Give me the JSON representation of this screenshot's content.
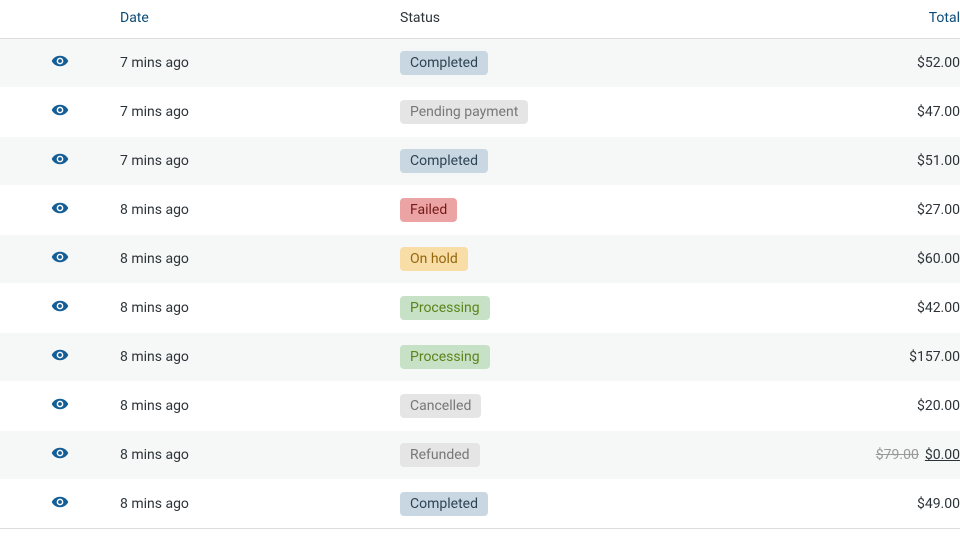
{
  "columns": {
    "date": {
      "label": "Date",
      "is_link": true
    },
    "status": {
      "label": "Status",
      "is_link": false
    },
    "total": {
      "label": "Total",
      "is_link": true
    }
  },
  "status_styles": {
    "Completed": "status-completed",
    "Pending payment": "status-pending",
    "Failed": "status-failed",
    "On hold": "status-onhold",
    "Processing": "status-processing",
    "Cancelled": "status-cancelled",
    "Refunded": "status-refunded"
  },
  "rows": [
    {
      "date": "7 mins ago",
      "status": "Completed",
      "total": "$52.00"
    },
    {
      "date": "7 mins ago",
      "status": "Pending payment",
      "total": "$47.00"
    },
    {
      "date": "7 mins ago",
      "status": "Completed",
      "total": "$51.00"
    },
    {
      "date": "8 mins ago",
      "status": "Failed",
      "total": "$27.00"
    },
    {
      "date": "8 mins ago",
      "status": "On hold",
      "total": "$60.00"
    },
    {
      "date": "8 mins ago",
      "status": "Processing",
      "total": "$42.00"
    },
    {
      "date": "8 mins ago",
      "status": "Processing",
      "total": "$157.00"
    },
    {
      "date": "8 mins ago",
      "status": "Cancelled",
      "total": "$20.00"
    },
    {
      "date": "8 mins ago",
      "status": "Refunded",
      "total_struck": "$79.00",
      "total": "$0.00",
      "underline_total": true
    },
    {
      "date": "8 mins ago",
      "status": "Completed",
      "total": "$49.00"
    }
  ]
}
